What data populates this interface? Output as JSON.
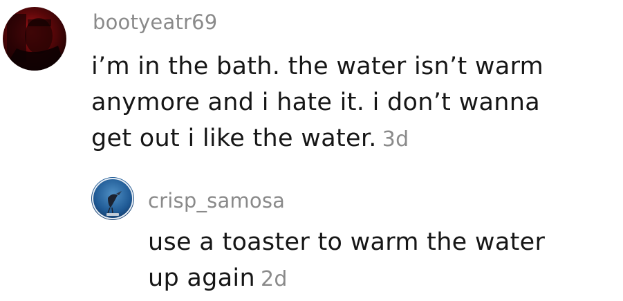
{
  "comments": [
    {
      "username": "bootyeatr69",
      "lines": [
        "i’m in the bath. the water isn’t warm",
        "anymore and i hate it. i don’t wanna",
        "get out i like the water."
      ],
      "timestamp": "3d",
      "avatar": "dark-red-profile-photo"
    },
    {
      "username": "crisp_samosa",
      "lines": [
        "use a toaster to warm the water",
        "up again"
      ],
      "timestamp": "2d",
      "avatar": "blue-bird-profile-photo",
      "is_reply": true
    }
  ],
  "colors": {
    "text": "#161616",
    "muted": "#8a8a8a",
    "background": "#ffffff"
  }
}
